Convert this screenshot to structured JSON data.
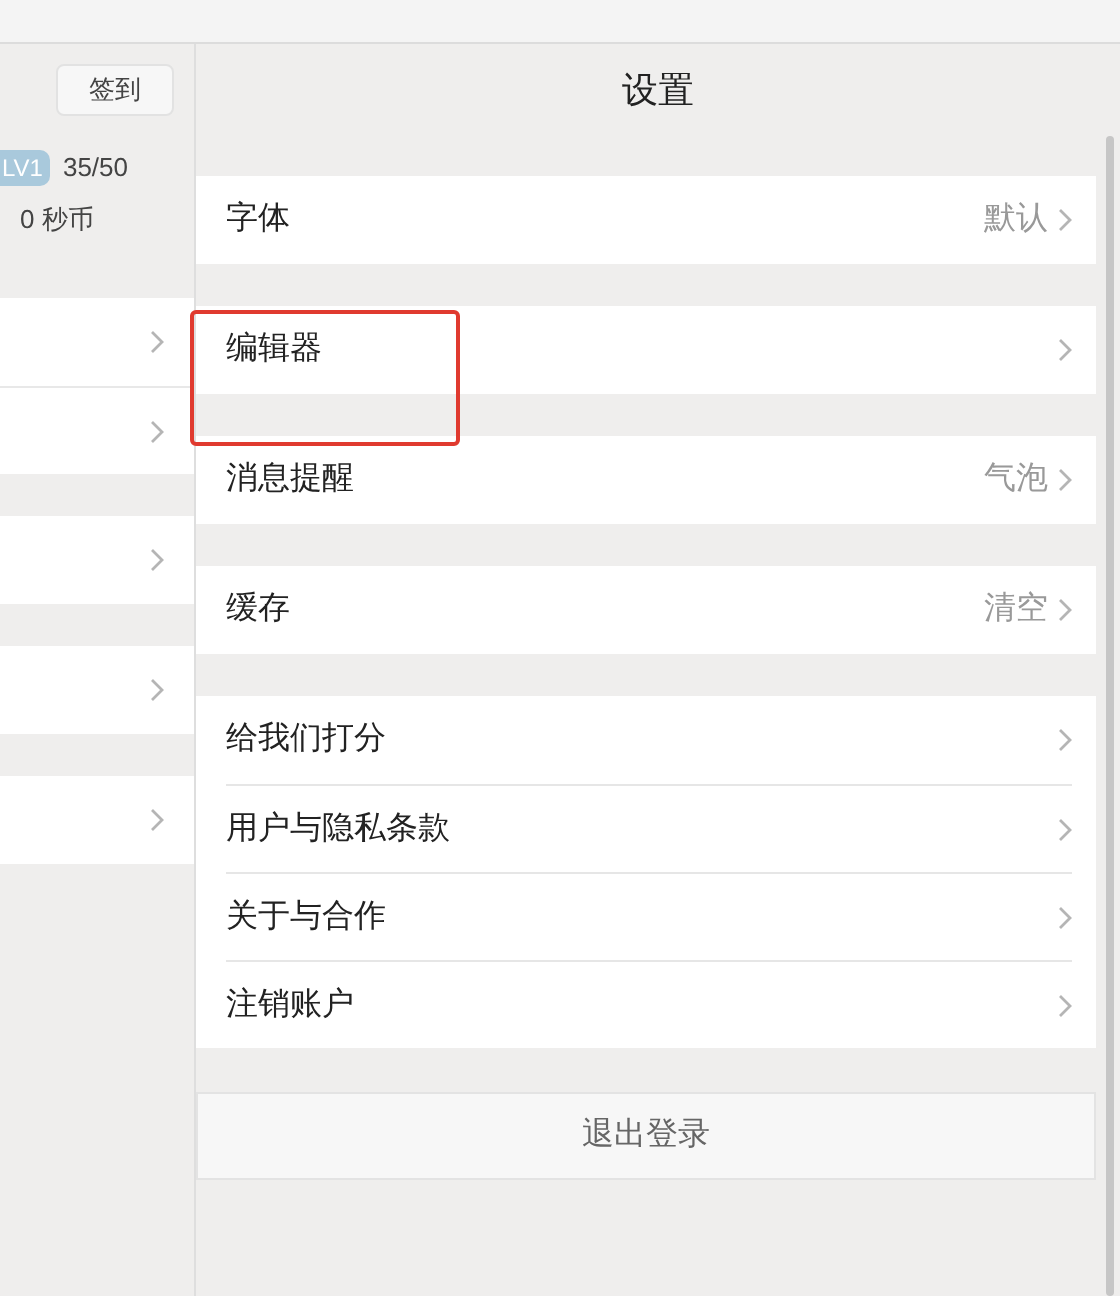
{
  "sidebar": {
    "checkin_button": "签到",
    "level_badge": "LV1",
    "progress": "35/50",
    "coins": "0 秒币",
    "groups": [
      {
        "rows": [
          {
            "kind": "link"
          },
          {
            "kind": "link"
          }
        ]
      },
      {
        "rows": [
          {
            "kind": "link"
          }
        ]
      },
      {
        "rows": [
          {
            "kind": "link"
          }
        ]
      },
      {
        "rows": [
          {
            "kind": "link"
          }
        ]
      }
    ]
  },
  "settings": {
    "title": "设置",
    "groups": [
      {
        "items": [
          {
            "label": "字体",
            "value": "默认",
            "highlighted": false
          }
        ]
      },
      {
        "items": [
          {
            "label": "编辑器",
            "highlighted": true
          }
        ]
      },
      {
        "items": [
          {
            "label": "消息提醒",
            "value": "气泡",
            "highlighted": false
          }
        ]
      },
      {
        "items": [
          {
            "label": "缓存",
            "value": "清空",
            "highlighted": false
          }
        ]
      },
      {
        "items": [
          {
            "label": "给我们打分",
            "highlighted": false
          },
          {
            "label": "用户与隐私条款",
            "highlighted": false
          },
          {
            "label": "关于与合作",
            "highlighted": false
          },
          {
            "label": "注销账户",
            "highlighted": false
          }
        ]
      }
    ],
    "logout_button": "退出登录"
  }
}
